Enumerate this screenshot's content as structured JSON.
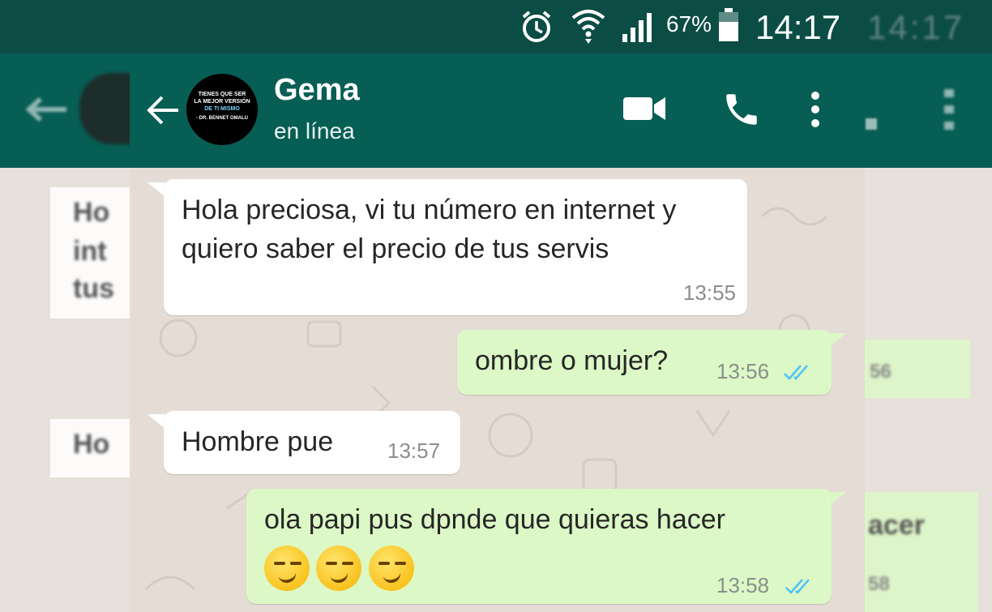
{
  "status_bar": {
    "battery": "67%",
    "time": "14:17",
    "time_ghost": "14:17"
  },
  "header": {
    "contact_name": "Gema",
    "contact_status": "en línea",
    "avatar_lines": [
      "TIENES QUE SER",
      "LA MEJOR VERSIÓN",
      "DE TI MISMO",
      "- DR. BENNET OMALU"
    ]
  },
  "messages": [
    {
      "direction": "in",
      "text": "Hola preciosa, vi tu número en internet y quiero saber el precio de tus servis",
      "time": "13:55"
    },
    {
      "direction": "out",
      "text": "ombre o mujer?",
      "time": "13:56",
      "read": true
    },
    {
      "direction": "in",
      "text": "Hombre pue",
      "time": "13:57"
    },
    {
      "direction": "out",
      "text": "ola papi pus dpnde que quieras hacer",
      "emoji_count": 3,
      "time": "13:58",
      "read": true
    }
  ],
  "ghost": {
    "left_lines": [
      "Ho",
      "int",
      "tus"
    ],
    "left_line2": "Ho",
    "right_time1": "56",
    "right_text": "acer",
    "right_time2": "58"
  },
  "colors": {
    "header": "#075e54",
    "status_bar": "#0b4d45",
    "outgoing_bubble": "#dcf8c6",
    "incoming_bubble": "#ffffff",
    "read_tick": "#4fc3f7"
  },
  "icons": [
    "alarm-icon",
    "wifi-icon",
    "signal-icon",
    "battery-icon",
    "back-arrow-icon",
    "video-call-icon",
    "phone-call-icon",
    "more-vert-icon",
    "double-check-icon",
    "smirk-emoji-icon"
  ]
}
